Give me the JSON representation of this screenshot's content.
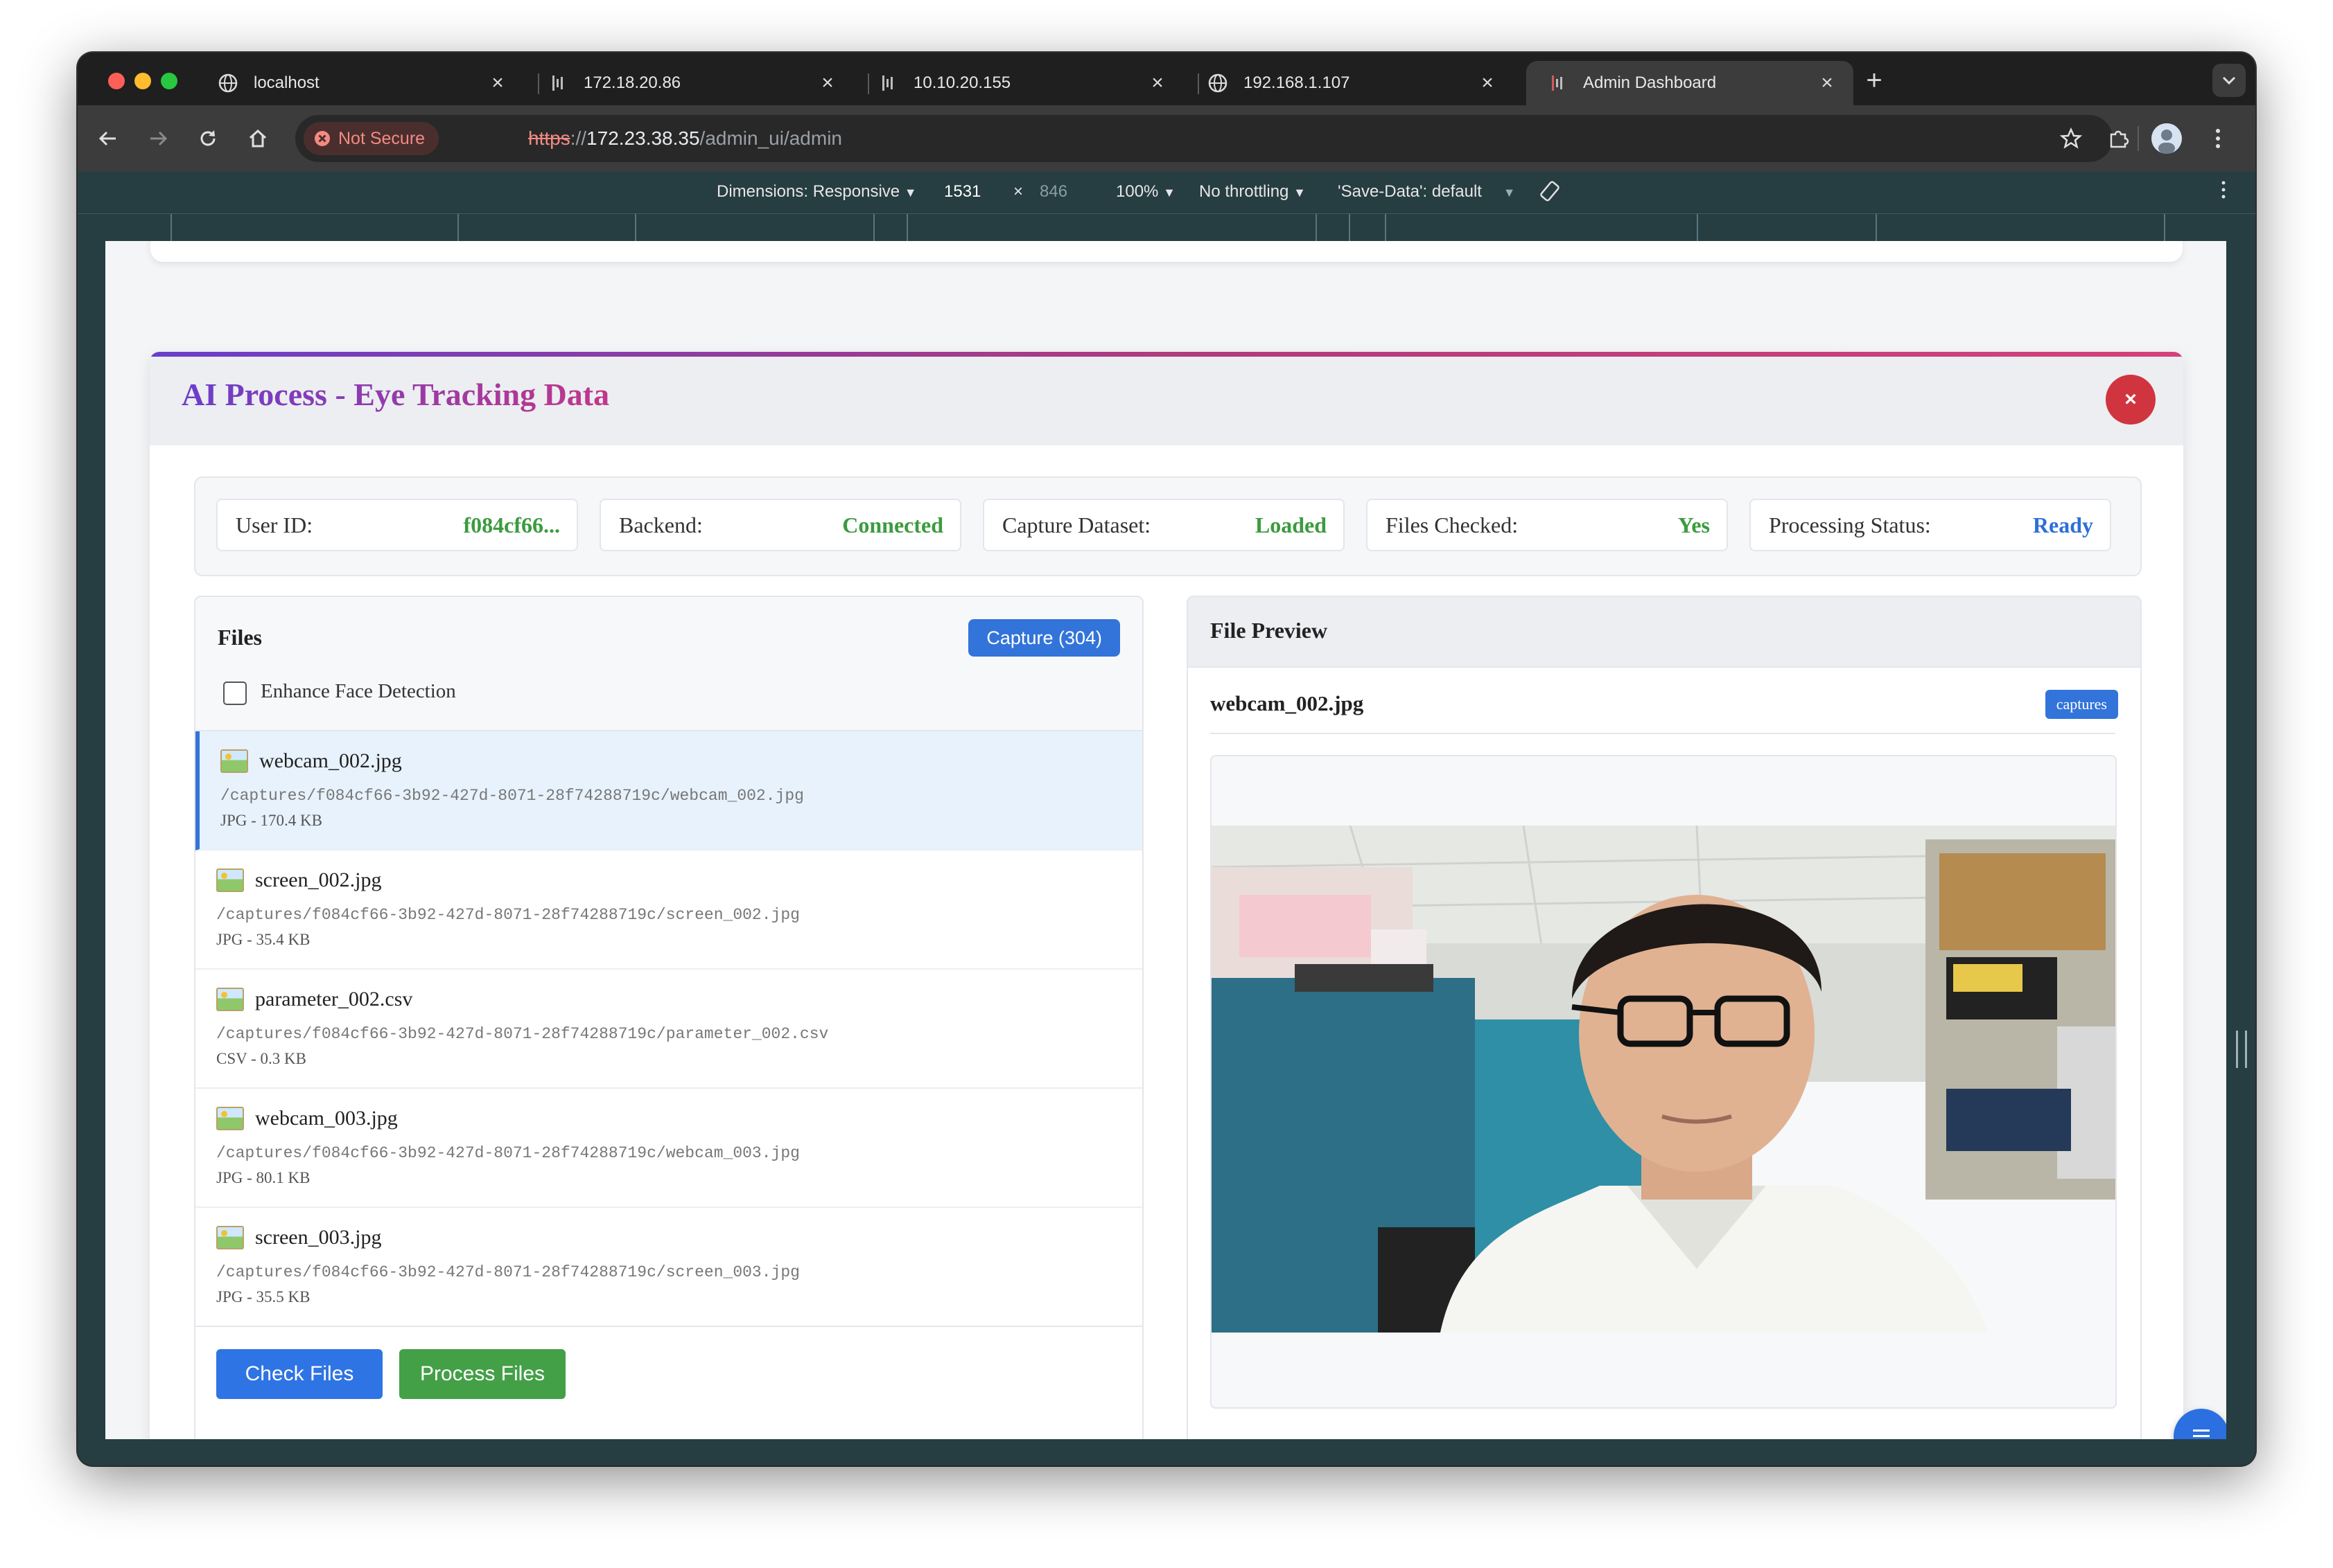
{
  "browser": {
    "tabs": [
      {
        "title": "localhost",
        "icon": "globe-icon"
      },
      {
        "title": "172.18.20.86",
        "icon": "site-favicon-icon"
      },
      {
        "title": "10.10.20.155",
        "icon": "site-favicon-icon"
      },
      {
        "title": "192.168.1.107",
        "icon": "globe-icon"
      },
      {
        "title": "Admin Dashboard",
        "icon": "site-favicon-icon",
        "active": true
      }
    ],
    "not_secure_label": "Not Secure",
    "url": {
      "scheme": "https",
      "sep": "://",
      "host": "172.23.38.35",
      "path": "/admin_ui/admin"
    }
  },
  "devtools": {
    "dimensions_label": "Dimensions: Responsive",
    "width": "1531",
    "times": "×",
    "height": "846",
    "zoom": "100%",
    "throttling": "No throttling",
    "save_data": "'Save-Data': default"
  },
  "modal": {
    "title": "AI Process - Eye Tracking Data",
    "close_symbol": "×"
  },
  "status": [
    {
      "label": "User ID:",
      "value": "f084cf66...",
      "color": "#3c9b3f"
    },
    {
      "label": "Backend:",
      "value": "Connected",
      "color": "#3c9b3f"
    },
    {
      "label": "Capture Dataset:",
      "value": "Loaded",
      "color": "#3c9b3f"
    },
    {
      "label": "Files Checked:",
      "value": "Yes",
      "color": "#3c9b3f"
    },
    {
      "label": "Processing Status:",
      "value": "Ready",
      "color": "#2d6fd6"
    }
  ],
  "files": {
    "heading": "Files",
    "capture_button": "Capture (304)",
    "enhance_label": "Enhance Face Detection",
    "enhance_checked": false,
    "items": [
      {
        "name": "webcam_002.jpg",
        "path": "/captures/f084cf66-3b92-427d-8071-28f74288719c/webcam_002.jpg",
        "meta": "JPG - 170.4 KB",
        "selected": true
      },
      {
        "name": "screen_002.jpg",
        "path": "/captures/f084cf66-3b92-427d-8071-28f74288719c/screen_002.jpg",
        "meta": "JPG - 35.4 KB"
      },
      {
        "name": "parameter_002.csv",
        "path": "/captures/f084cf66-3b92-427d-8071-28f74288719c/parameter_002.csv",
        "meta": "CSV - 0.3 KB"
      },
      {
        "name": "webcam_003.jpg",
        "path": "/captures/f084cf66-3b92-427d-8071-28f74288719c/webcam_003.jpg",
        "meta": "JPG - 80.1 KB"
      },
      {
        "name": "screen_003.jpg",
        "path": "/captures/f084cf66-3b92-427d-8071-28f74288719c/screen_003.jpg",
        "meta": "JPG - 35.5 KB"
      }
    ],
    "check_button": "Check Files",
    "process_button": "Process Files"
  },
  "preview": {
    "heading": "File Preview",
    "file_name": "webcam_002.jpg",
    "badge": "captures"
  },
  "colors": {
    "primary": "#3274d9",
    "success": "#43a047",
    "danger": "#d0343f",
    "accent_gradient": [
      "#6a3ecb",
      "#c0378a"
    ]
  }
}
